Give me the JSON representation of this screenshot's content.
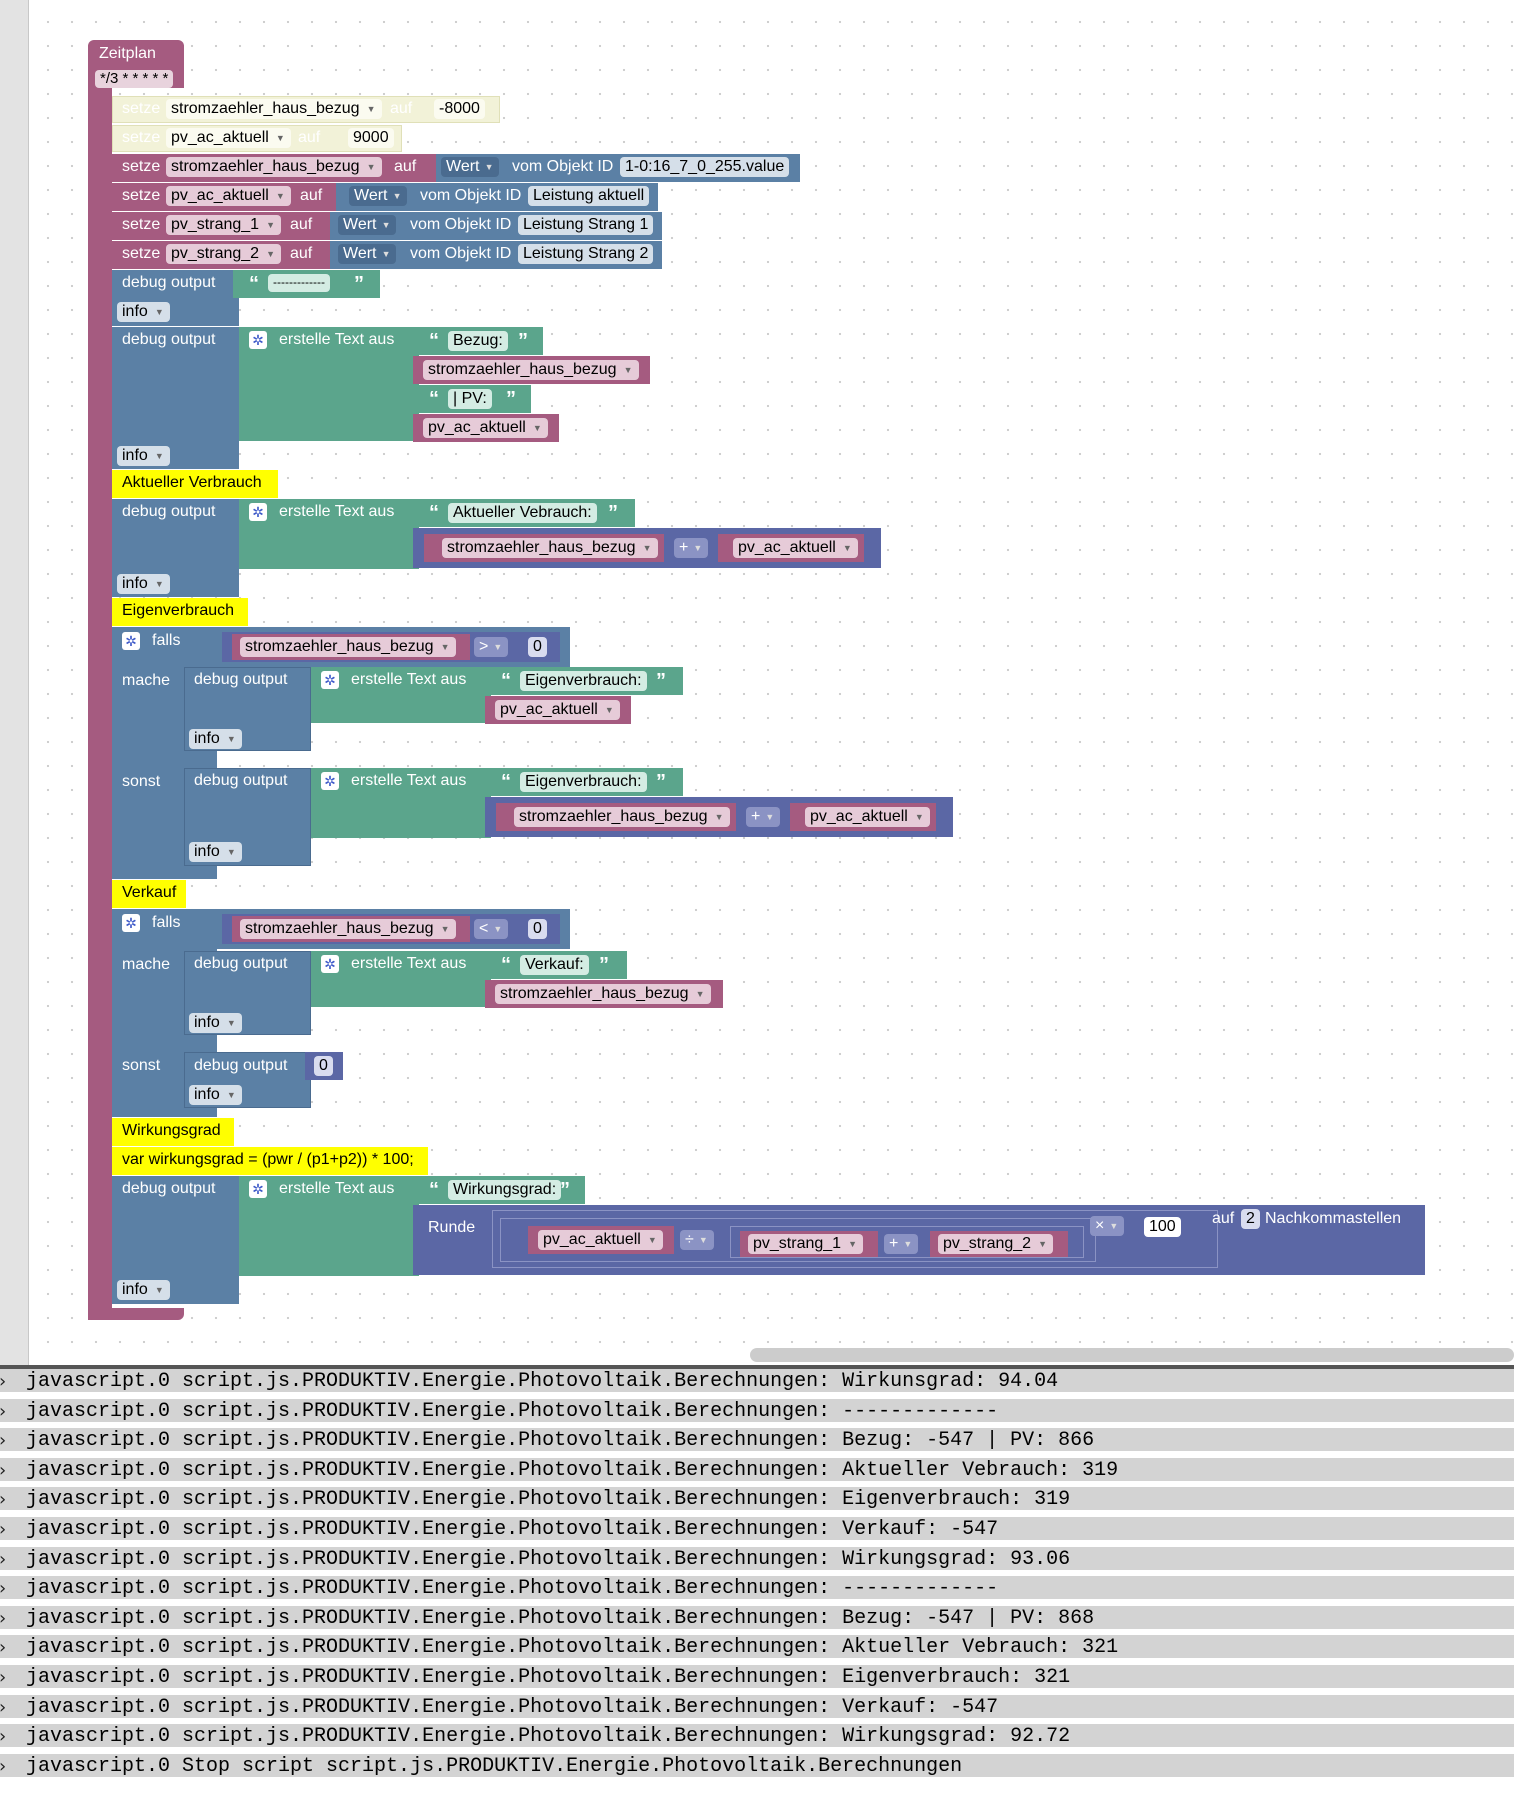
{
  "blocks": {
    "schedule": {
      "label": "Zeitplan",
      "cron": "*/3 * * * * *"
    },
    "disabled_set_1": {
      "keyword_set": "setze",
      "variable": "stromzaehler_haus_bezug",
      "keyword_to": "auf",
      "value": "-8000"
    },
    "disabled_set_2": {
      "keyword_set": "setze",
      "variable": "pv_ac_aktuell",
      "keyword_to": "auf",
      "value": "9000"
    },
    "set_1": {
      "keyword_set": "setze",
      "variable": "stromzaehler_haus_bezug",
      "keyword_to": "auf",
      "property": "Wert",
      "of_object": "vom Objekt ID",
      "object_id": "1-0:16_7_0_255.value"
    },
    "set_2": {
      "keyword_set": "setze",
      "variable": "pv_ac_aktuell",
      "keyword_to": "auf",
      "property": "Wert",
      "of_object": "vom Objekt ID",
      "object_id": "Leistung aktuell"
    },
    "set_3": {
      "keyword_set": "setze",
      "variable": "pv_strang_1",
      "keyword_to": "auf",
      "property": "Wert",
      "of_object": "vom Objekt ID",
      "object_id": "Leistung Strang 1"
    },
    "set_4": {
      "keyword_set": "setze",
      "variable": "pv_strang_2",
      "keyword_to": "auf",
      "property": "Wert",
      "of_object": "vom Objekt ID",
      "object_id": "Leistung Strang 2"
    },
    "debug_1": {
      "label": "debug output",
      "text": "-------------",
      "level": "info"
    },
    "debug_2": {
      "label": "debug output",
      "join": "erstelle Text aus",
      "text_1": "Bezug:",
      "var_1": "stromzaehler_haus_bezug",
      "text_2": "| PV:",
      "var_2": "pv_ac_aktuell",
      "level": "info"
    },
    "comment_1": "Aktueller Verbrauch",
    "debug_3": {
      "label": "debug output",
      "join": "erstelle Text aus",
      "text_1": "Aktueller Vebrauch:",
      "var_1": "stromzaehler_haus_bezug",
      "op": "+",
      "var_2": "pv_ac_aktuell",
      "level": "info"
    },
    "comment_2": "Eigenverbrauch",
    "if_1": {
      "if_label": "falls",
      "var": "stromzaehler_haus_bezug",
      "op": ">",
      "compare": "0",
      "then_label": "mache",
      "then_debug": {
        "label": "debug output",
        "join": "erstelle Text aus",
        "text_1": "Eigenverbrauch:",
        "var_1": "pv_ac_aktuell",
        "level": "info"
      },
      "else_label": "sonst",
      "else_debug": {
        "label": "debug output",
        "join": "erstelle Text aus",
        "text_1": "Eigenverbrauch:",
        "var_1": "stromzaehler_haus_bezug",
        "op": "+",
        "var_2": "pv_ac_aktuell",
        "level": "info"
      }
    },
    "comment_3": "Verkauf",
    "if_2": {
      "if_label": "falls",
      "var": "stromzaehler_haus_bezug",
      "op": "<",
      "compare": "0",
      "then_label": "mache",
      "then_debug": {
        "label": "debug output",
        "join": "erstelle Text aus",
        "text_1": "Verkauf:",
        "var_1": "stromzaehler_haus_bezug",
        "level": "info"
      },
      "else_label": "sonst",
      "else_debug": {
        "label": "debug output",
        "value": "0",
        "level": "info"
      }
    },
    "comment_4": "Wirkungsgrad",
    "code_line": "var wirkungsgrad = (pwr / (p1+p2)) * 100;",
    "debug_4": {
      "label": "debug output",
      "join": "erstelle Text aus",
      "text_1": "Wirkungsgrad:",
      "round": "Runde",
      "var_1": "pv_ac_aktuell",
      "op_div": "÷",
      "var_2": "pv_strang_1",
      "op_add": "+",
      "var_3": "pv_strang_2",
      "op_mul": "×",
      "factor": "100",
      "to": "auf",
      "decimals": "2",
      "decimals_label": "Nachkommastellen",
      "level": "info"
    }
  },
  "log": [
    "javascript.0 script.js.PRODUKTIV.Energie.Photovoltaik.Berechnungen: Wirkunsgrad: 94.04",
    "javascript.0 script.js.PRODUKTIV.Energie.Photovoltaik.Berechnungen: -------------",
    "javascript.0 script.js.PRODUKTIV.Energie.Photovoltaik.Berechnungen: Bezug: -547 | PV: 866",
    "javascript.0 script.js.PRODUKTIV.Energie.Photovoltaik.Berechnungen: Aktueller Vebrauch: 319",
    "javascript.0 script.js.PRODUKTIV.Energie.Photovoltaik.Berechnungen: Eigenverbrauch: 319",
    "javascript.0 script.js.PRODUKTIV.Energie.Photovoltaik.Berechnungen: Verkauf: -547",
    "javascript.0 script.js.PRODUKTIV.Energie.Photovoltaik.Berechnungen: Wirkungsgrad: 93.06",
    "javascript.0 script.js.PRODUKTIV.Energie.Photovoltaik.Berechnungen: -------------",
    "javascript.0 script.js.PRODUKTIV.Energie.Photovoltaik.Berechnungen: Bezug: -547 | PV: 868",
    "javascript.0 script.js.PRODUKTIV.Energie.Photovoltaik.Berechnungen: Aktueller Vebrauch: 321",
    "javascript.0 script.js.PRODUKTIV.Energie.Photovoltaik.Berechnungen: Eigenverbrauch: 321",
    "javascript.0 script.js.PRODUKTIV.Energie.Photovoltaik.Berechnungen: Verkauf: -547",
    "javascript.0 script.js.PRODUKTIV.Energie.Photovoltaik.Berechnungen: Wirkungsgrad: 92.72",
    "javascript.0 Stop script script.js.PRODUKTIV.Energie.Photovoltaik.Berechnungen"
  ],
  "colors": {
    "variable": "#A55B80",
    "value": "#5B67A5",
    "text": "#5BA58C",
    "debug": "#5B80A5",
    "comment": "#ffff00",
    "disabled": "#f2f2d8"
  }
}
